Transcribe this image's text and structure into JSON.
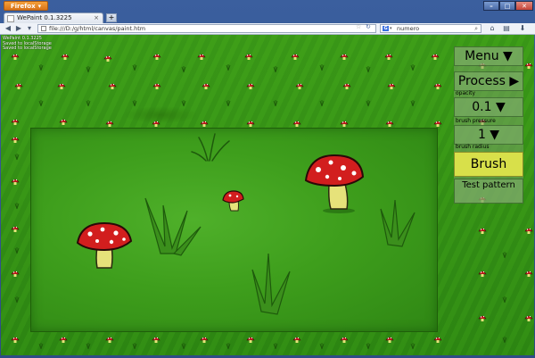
{
  "browser": {
    "app_button": "Firefox",
    "tab_title": "WePaint 0.1.3225",
    "new_tab": "+",
    "url": "file:///D:/g/html/canvas/paint.htm",
    "search_value": "numero",
    "search_engine": "G"
  },
  "status_lines": "WePaint 0.1.3225\nSaved to localStorage\nSaved to localStorage",
  "panel": {
    "menu_label": "Menu ▼",
    "process_label": "Process ▶",
    "opacity_caption": "opacity",
    "opacity_value": "0.1 ▼",
    "pressure_caption": "brush pressure",
    "pressure_value": "1 ▼",
    "radius_caption": "brush radius",
    "brush_label": "Brush",
    "test_pattern_label": "Test pattern"
  },
  "colors": {
    "grass": "#3fa21a",
    "mushroom_cap": "#d21e1e",
    "mushroom_stem": "#e6e27a",
    "brush_button": "#d8e04a"
  }
}
